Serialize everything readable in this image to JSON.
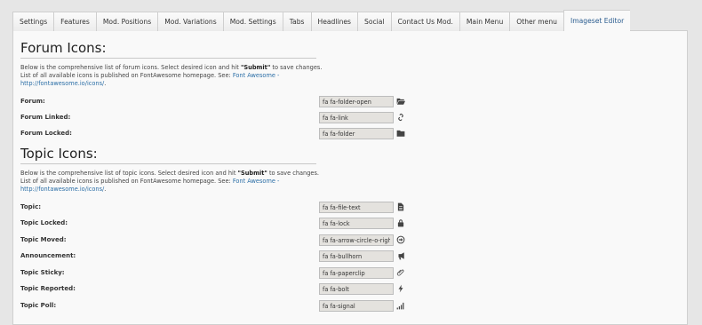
{
  "tabs": [
    {
      "label": "Settings",
      "name": "tab-settings"
    },
    {
      "label": "Features",
      "name": "tab-features"
    },
    {
      "label": "Mod. Positions",
      "name": "tab-mod-positions"
    },
    {
      "label": "Mod. Variations",
      "name": "tab-mod-variations"
    },
    {
      "label": "Mod. Settings",
      "name": "tab-mod-settings"
    },
    {
      "label": "Tabs",
      "name": "tab-tabs"
    },
    {
      "label": "Headlines",
      "name": "tab-headlines"
    },
    {
      "label": "Social",
      "name": "tab-social"
    },
    {
      "label": "Contact Us Mod.",
      "name": "tab-contact-us-mod"
    },
    {
      "label": "Main Menu",
      "name": "tab-main-menu"
    },
    {
      "label": "Other menu",
      "name": "tab-other-menu"
    },
    {
      "label": "Imageset Editor",
      "name": "tab-imageset-editor"
    }
  ],
  "active_tab": "Imageset Editor",
  "forum": {
    "title": "Forum Icons:",
    "desc_1": "Below is the comprehensive list of forum icons. Select desired icon and hit ",
    "desc_submit": "\"Submit\"",
    "desc_2": " to save changes. List of all available icons is published on FontAwesome homepage. See: ",
    "link_text": "Font Awesome - http://fontawesome.io/icons/",
    "desc_end": ".",
    "rows": [
      {
        "label": "Forum:",
        "value": "fa fa-folder-open",
        "icon": "folder-open-icon"
      },
      {
        "label": "Forum Linked:",
        "value": "fa fa-link",
        "icon": "link-icon"
      },
      {
        "label": "Forum Locked:",
        "value": "fa fa-folder",
        "icon": "folder-icon"
      }
    ]
  },
  "topic": {
    "title": "Topic Icons:",
    "desc_1": "Below is the comprehensive list of topic icons. Select desired icon and hit ",
    "desc_submit": "\"Submit\"",
    "desc_2": " to save changes. List of all available icons is published on FontAwesome homepage. See: ",
    "link_text": "Font Awesome - http://fontawesome.io/icons/",
    "desc_end": ".",
    "rows": [
      {
        "label": "Topic:",
        "value": "fa fa-file-text",
        "icon": "file-text-icon"
      },
      {
        "label": "Topic Locked:",
        "value": "fa fa-lock",
        "icon": "lock-icon"
      },
      {
        "label": "Topic Moved:",
        "value": "fa fa-arrow-circle-o-right",
        "icon": "arrow-circle-right-icon"
      },
      {
        "label": "Announcement:",
        "value": "fa fa-bullhorn",
        "icon": "bullhorn-icon"
      },
      {
        "label": "Topic Sticky:",
        "value": "fa fa-paperclip",
        "icon": "paperclip-icon"
      },
      {
        "label": "Topic Reported:",
        "value": "fa fa-bolt",
        "icon": "bolt-icon"
      },
      {
        "label": "Topic Poll:",
        "value": "fa fa-signal",
        "icon": "signal-icon"
      }
    ]
  }
}
